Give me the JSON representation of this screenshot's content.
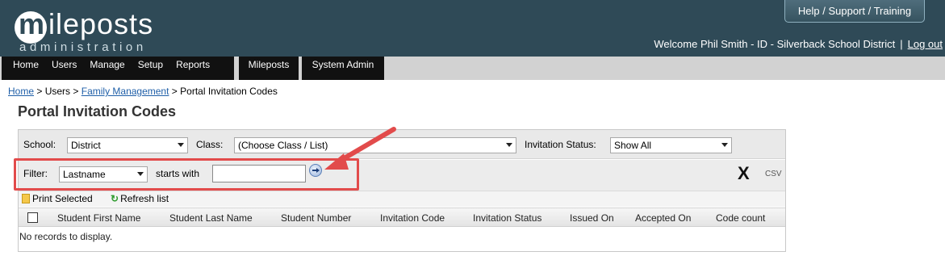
{
  "header": {
    "logo_main": "ileposts",
    "logo_initial": "m",
    "logo_sub": "administration",
    "help_button": "Help / Support / Training",
    "welcome_text": "Welcome Phil Smith - ID - Silverback School District",
    "separator": "|",
    "logout": "Log out"
  },
  "nav": {
    "items": [
      "Home",
      "Users",
      "Manage",
      "Setup",
      "Reports"
    ],
    "mileposts": "Mileposts",
    "system_admin": "System Admin"
  },
  "breadcrumb": {
    "home": "Home",
    "sep1": " > ",
    "users": "Users",
    "sep2": " > ",
    "family": "Family Management",
    "sep3": " > ",
    "current": "Portal Invitation Codes"
  },
  "page_title": "Portal Invitation Codes",
  "filters": {
    "school_label": "School:",
    "school_value": "District",
    "class_label": "Class:",
    "class_value": "(Choose Class / List)",
    "status_label": "Invitation Status:",
    "status_value": "Show All",
    "filter_label": "Filter:",
    "filter_value": "Lastname",
    "starts_with_label": "starts with",
    "starts_with_value": "",
    "clear_label": "X",
    "csv_label": "CSV"
  },
  "toolbar": {
    "print_selected": "Print Selected",
    "refresh_list": "Refresh list"
  },
  "grid": {
    "columns": [
      "Student First Name",
      "Student Last Name",
      "Student Number",
      "Invitation Code",
      "Invitation Status",
      "Issued On",
      "Accepted On",
      "Code count"
    ],
    "empty_message": "No records to display."
  },
  "colors": {
    "header_bg": "#2f4a57",
    "nav_bg": "#111111",
    "annotation": "#e24b4b",
    "link": "#1f5fa8"
  }
}
